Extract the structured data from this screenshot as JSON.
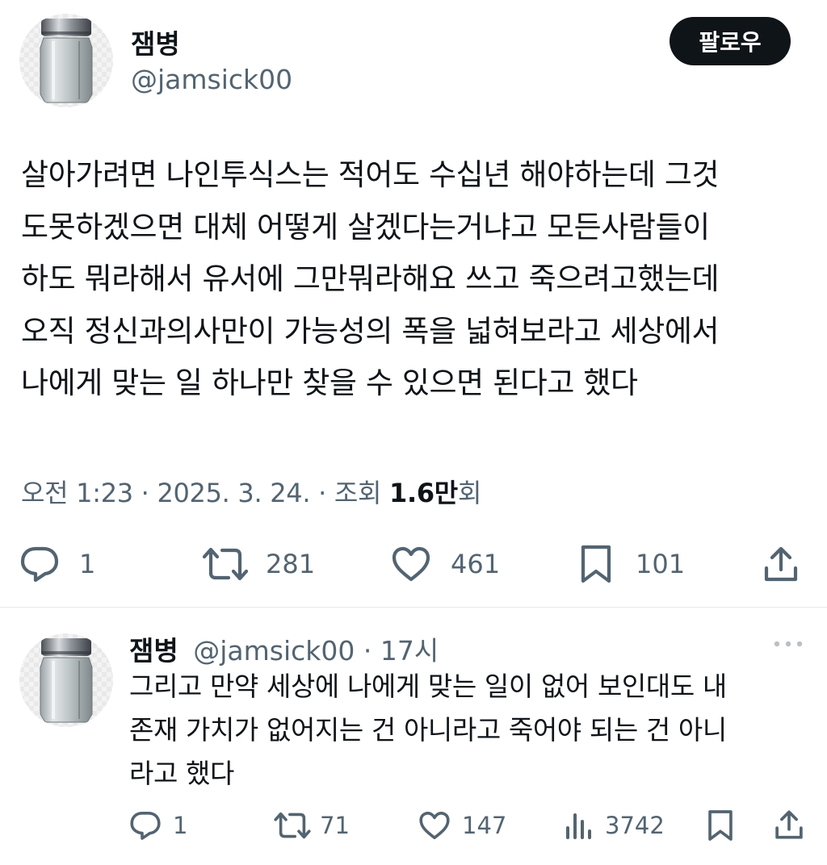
{
  "tweet": {
    "author_name": "잼병",
    "author_handle": "@jamsick00",
    "follow_label": "팔로우",
    "text_lines": [
      "살아가려면 나인투식스는 적어도 수십년 해야하는데 그것",
      "도못하겠으면 대체 어떻게 살겠다는거냐고 모든사람들이",
      "하도 뭐라해서 유서에 그만뭐라해요 쓰고 죽으려고했는데",
      "오직 정신과의사만이 가능성의 폭을 넓혀보라고 세상에서",
      "나에게 맞는 일 하나만 찾을 수 있으면 된다고 했다"
    ],
    "meta": {
      "time": "오전 1:23",
      "sep1": " · ",
      "date": "2025. 3. 24.",
      "sep2": " · ",
      "views_label": "조회 ",
      "views_count": "1.6만",
      "views_suffix": "회"
    },
    "actions": {
      "replies": "1",
      "retweets": "281",
      "likes": "461",
      "bookmarks": "101"
    }
  },
  "reply": {
    "author_name": "잼병",
    "author_handle": "@jamsick00",
    "time_sep": " · ",
    "time": "17시",
    "text_lines": [
      "그리고 만약 세상에 나에게 맞는 일이 없어 보인대도 내",
      "존재 가치가 없어지는 건 아니라고 죽어야 되는 건 아니",
      "라고 했다"
    ],
    "actions": {
      "replies": "1",
      "retweets": "71",
      "likes": "147",
      "views": "3742"
    }
  },
  "icons": {
    "avatar": "jar-icon",
    "reply": "reply-icon",
    "retweet": "retweet-icon",
    "like": "heart-icon",
    "bookmark": "bookmark-icon",
    "share": "share-icon",
    "views": "analytics-icon",
    "more": "more-icon"
  },
  "colors": {
    "text": "#0f1419",
    "secondary": "#536471",
    "button": "#0f1419",
    "divider": "#e6e8ea"
  }
}
